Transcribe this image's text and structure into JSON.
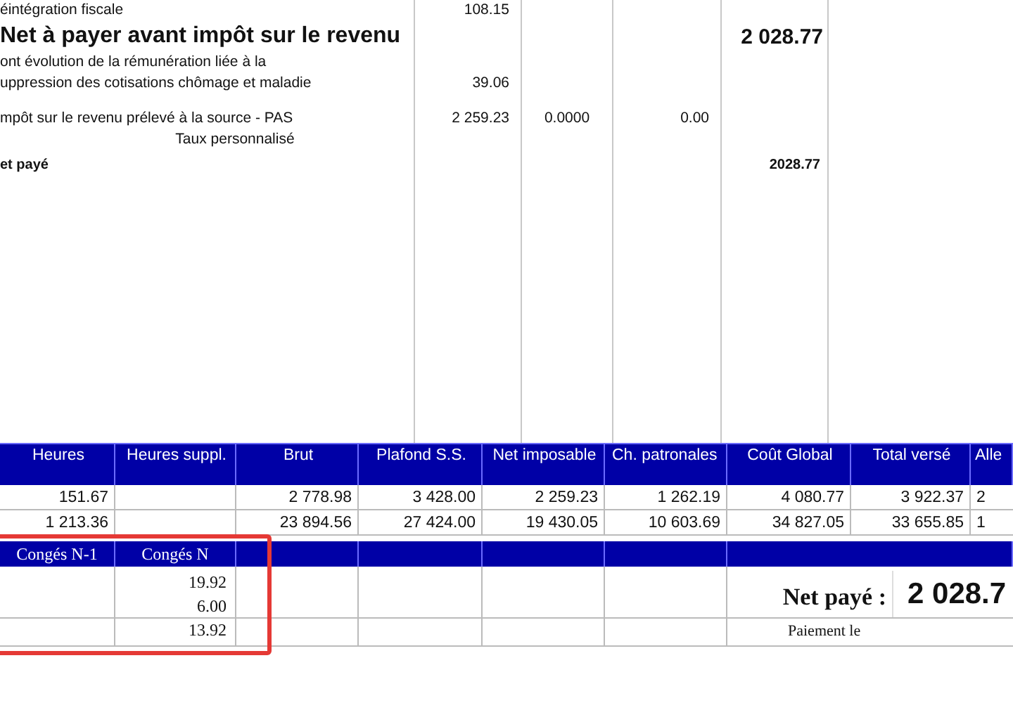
{
  "pay_lines": [
    {
      "kind": "plain",
      "label": [
        "éintégration fiscale"
      ],
      "base": "108.15"
    },
    {
      "kind": "heading",
      "label": [
        "Net à payer avant impôt sur le revenu"
      ],
      "net": "2 028.77"
    },
    {
      "kind": "plain",
      "label": [
        "ont évolution de la rémunération liée à la",
        "uppression des cotisations chômage et maladie"
      ],
      "base": "39.06"
    },
    {
      "kind": "spaced",
      "label": [
        "mpôt sur le revenu prélevé à la source - PAS"
      ],
      "base": "2 259.23",
      "rate": "0.0000",
      "gain": "0.00"
    },
    {
      "kind": "note",
      "label": [
        "Taux personnalisé"
      ]
    },
    {
      "kind": "total",
      "label": [
        "et payé"
      ],
      "net": "2028.77"
    }
  ],
  "summary_table": {
    "columns": [
      "Heures",
      "Heures suppl.",
      "Brut",
      "Plafond S.S.",
      "Net imposable",
      "Ch. patronales",
      "Coût Global",
      "Total versé",
      "Alle"
    ],
    "rows": [
      [
        "151.67",
        null,
        "2 778.98",
        "3 428.00",
        "2 259.23",
        "1 262.19",
        "4 080.77",
        "3 922.37",
        "2"
      ],
      [
        "1 213.36",
        null,
        "23 894.56",
        "27 424.00",
        "19 430.05",
        "10 603.69",
        "34 827.05",
        "33 655.85",
        "1"
      ]
    ]
  },
  "leave_table": {
    "highlighted": true,
    "columns": [
      "Congés N-1",
      "Congés N"
    ],
    "rows": [
      {
        "conges_n": [
          "19.92",
          "6.00"
        ]
      },
      {
        "conges_n": [
          "13.92"
        ]
      }
    ]
  },
  "net_pay": {
    "label": "Net payé :",
    "value": "2 028.7"
  },
  "payment": {
    "label": "Paiement le"
  }
}
